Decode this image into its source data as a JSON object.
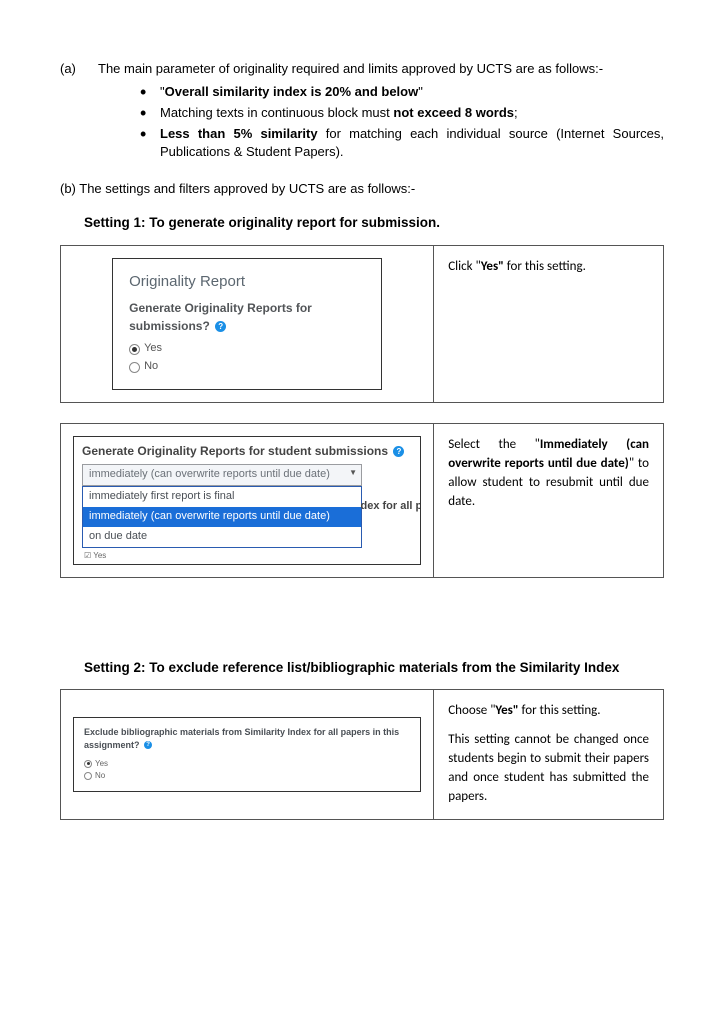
{
  "section_a": {
    "label": "(a)",
    "text": "The main parameter of originality required and limits approved by UCTS are as follows:-",
    "bullets": [
      {
        "pre": "\"",
        "bold": "Overall similarity index is 20% and below",
        "post": "\""
      },
      {
        "pre": "Matching texts in continuous block must ",
        "bold": "not exceed 8 words",
        "post": ";"
      },
      {
        "pre": "",
        "bold": "Less than 5% similarity",
        "post": " for matching each individual source (Internet Sources, Publications & Student Papers)."
      }
    ]
  },
  "section_b": {
    "text": "(b) The settings and filters approved by UCTS are as follows:-"
  },
  "setting1_title": "Setting 1: To generate originality report for submission.",
  "panel1": {
    "box_title": "Originality Report",
    "question": "Generate Originality Reports for submissions?",
    "opt_yes": "Yes",
    "opt_no": "No",
    "instruction_pre": "Click \"",
    "instruction_bold": "Yes\"",
    "instruction_post": " for this setting."
  },
  "panel2": {
    "question": "Generate Originality Reports for student submissions",
    "selected_display": "immediately (can overwrite reports until due date)",
    "options": [
      "immediately first report is final",
      "immediately (can overwrite reports until due date)",
      "on due date"
    ],
    "trailing": "dex for all p",
    "tiny_label": "☑ Yes",
    "instr_pre": "Select the \"",
    "instr_bold": "Immediately (can overwrite reports until due date)",
    "instr_post": "\" to allow student to resubmit until due date."
  },
  "setting2_title": "Setting 2: To exclude reference list/bibliographic materials from the Similarity Index",
  "panel3": {
    "question": "Exclude bibliographic materials from Similarity Index for all papers in this assignment?",
    "opt_yes": "Yes",
    "opt_no": "No",
    "instr1_pre": "Choose \"",
    "instr1_bold": "Yes\"",
    "instr1_post": " for this setting.",
    "instr2": "This setting cannot be changed once students begin to submit their papers and once student has submitted the papers."
  }
}
